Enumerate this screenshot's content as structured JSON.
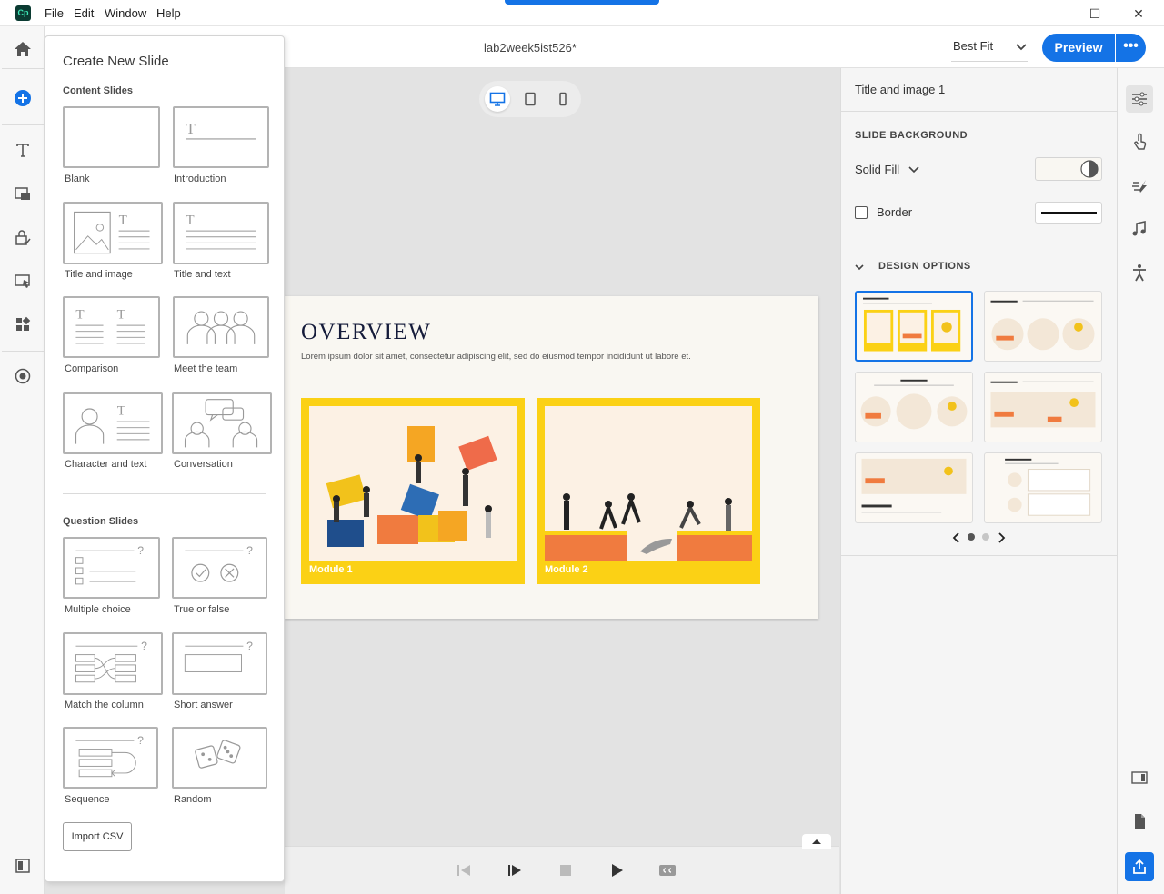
{
  "app": {
    "logo_text": "Cp",
    "menu": [
      "File",
      "Edit",
      "Window",
      "Help"
    ],
    "window_controls": [
      "—",
      "☐",
      "✕"
    ]
  },
  "header": {
    "doc_title": "lab2week5ist526*",
    "zoom": "Best Fit",
    "preview_label": "Preview",
    "more_label": "•••"
  },
  "flyout": {
    "title": "Create New Slide",
    "content_section": "Content Slides",
    "content_slides": [
      "Blank",
      "Introduction",
      "Title and image",
      "Title and text",
      "Comparison",
      "Meet the team",
      "Character and text",
      "Conversation"
    ],
    "question_section": "Question Slides",
    "question_slides": [
      "Multiple choice",
      "True or false",
      "Match the column",
      "Short answer",
      "Sequence",
      "Random"
    ],
    "import_label": "Import CSV"
  },
  "slide": {
    "title": "OVERVIEW",
    "body": "Lorem ipsum dolor sit amet, consectetur adipiscing elit, sed do eiusmod tempor incididunt ut labore et.",
    "module_1": "Module 1",
    "module_2": "Module 2"
  },
  "panel": {
    "title": "Title and image 1",
    "background_section": "SLIDE BACKGROUND",
    "fill_type": "Solid Fill",
    "border_label": "Border",
    "design_section": "DESIGN OPTIONS"
  },
  "colors": {
    "accent": "#1473e6",
    "module_yellow": "#fbd115",
    "slide_bg": "#f9f7f2",
    "title_navy": "#151b3a"
  }
}
